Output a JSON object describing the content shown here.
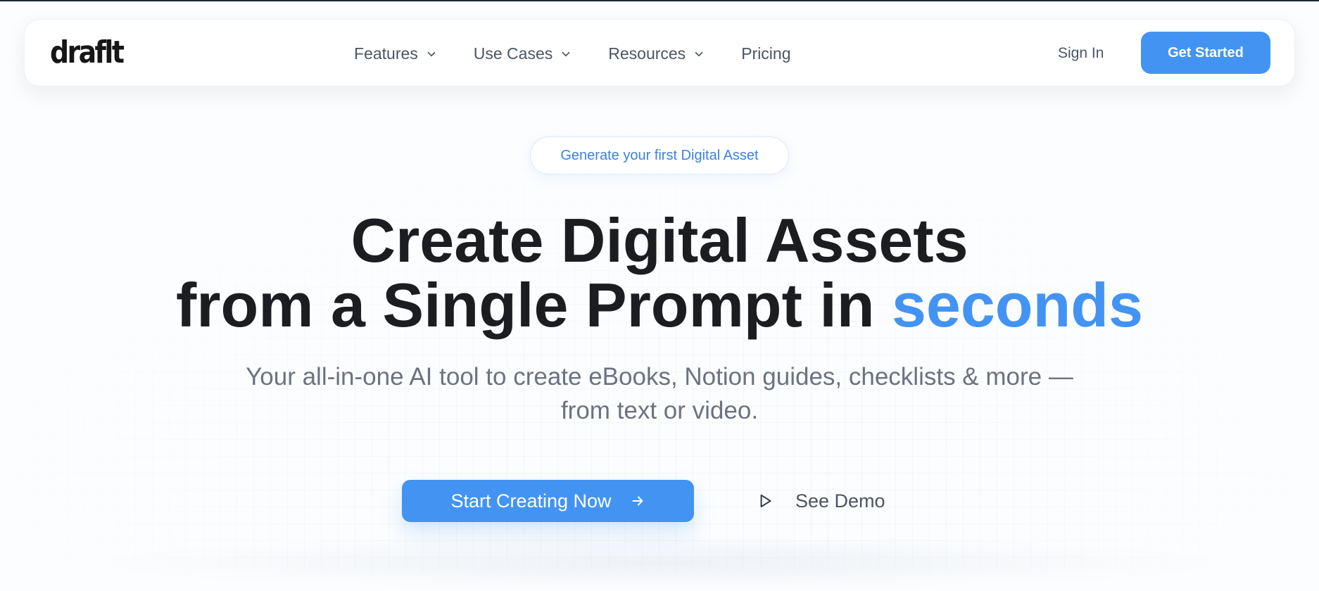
{
  "brand": {
    "logo_text": "draflt"
  },
  "nav": {
    "items": [
      {
        "label": "Features",
        "icon": "chevron-down-icon"
      },
      {
        "label": "Use Cases",
        "icon": "chevron-down-icon"
      },
      {
        "label": "Resources",
        "icon": "chevron-down-icon"
      },
      {
        "label": "Pricing"
      }
    ],
    "sign_in": "Sign In",
    "get_started": "Get Started"
  },
  "hero": {
    "pill": "Generate your first Digital Asset",
    "headline_line1": "Create Digital Assets",
    "headline_line2_prefix": "from a Single Prompt in ",
    "headline_accent": "seconds",
    "subtitle_line1": "Your all-in-one AI tool to create eBooks, Notion guides, checklists & more —",
    "subtitle_line2": "from text or video.",
    "cta_primary": "Start Creating Now",
    "cta_primary_icon": "arrow-right-icon",
    "cta_secondary": "See Demo",
    "cta_secondary_icon": "play-icon"
  },
  "colors": {
    "accent": "#4394f2",
    "text_dark": "#1b1d21",
    "text_muted": "#6b7280"
  }
}
